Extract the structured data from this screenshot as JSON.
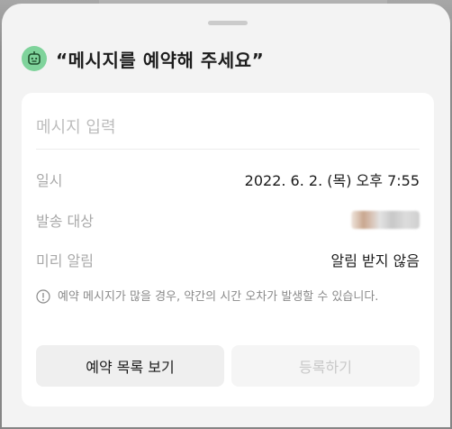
{
  "sheet": {
    "title": "“메시지를 예약해 주세요”",
    "bot_icon": "bot-face-icon",
    "accent_color": "#7fd39b"
  },
  "form": {
    "message_placeholder": "메시지 입력",
    "datetime_label": "일시",
    "datetime_value": "2022. 6. 2. (목) 오후 7:55",
    "recipient_label": "발송 대상",
    "recipient_value": "(blurred)",
    "reminder_label": "미리 알림",
    "reminder_value": "알림 받지 않음",
    "notice_icon": "info-icon",
    "notice_text": "예약 메시지가 많을 경우, 약간의 시간 오차가 발생할 수 있습니다."
  },
  "actions": {
    "list_button": "예약 목록 보기",
    "register_button": "등록하기"
  }
}
